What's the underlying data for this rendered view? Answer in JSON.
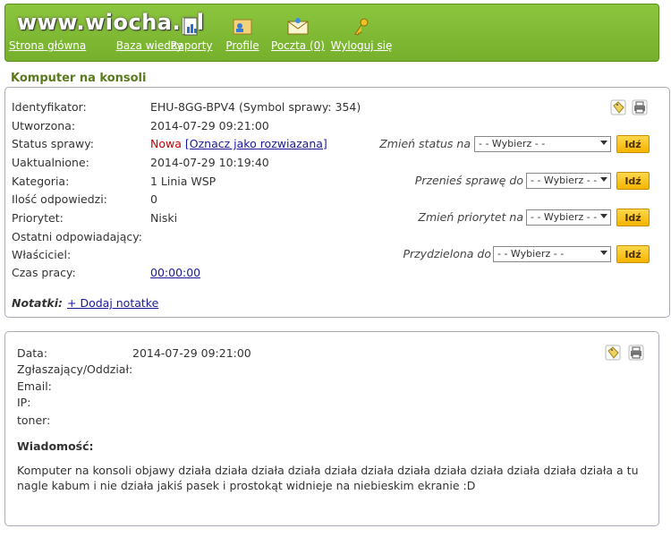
{
  "header": {
    "logo": "www.wiocha.pl",
    "nav": [
      {
        "label": "Strona główna",
        "icon": "home-icon"
      },
      {
        "label": "Baza wiedzy",
        "icon": "knowledge-base-icon"
      },
      {
        "label": "Raporty",
        "icon": "reports-icon"
      },
      {
        "label": "Profile",
        "icon": "profile-icon"
      },
      {
        "label": "Poczta (0)",
        "icon": "mail-icon"
      },
      {
        "label": "Wyloguj się",
        "icon": "key-icon"
      }
    ]
  },
  "page_title": "Komputer na konsoli",
  "ticket": {
    "fields": [
      {
        "label": "Identyfikator:",
        "value": "EHU-8GG-BPV4 (Symbol sprawy: 354)"
      },
      {
        "label": "Utworzona:",
        "value": "2014-07-29 09:21:00"
      },
      {
        "label": "Status sprawy:",
        "value": "Nowa",
        "link": "[Oznacz jako rozwiazana]"
      },
      {
        "label": "Uaktualnione:",
        "value": "2014-07-29 10:19:40"
      },
      {
        "label": "Kategoria:",
        "value": "1 Linia WSP"
      },
      {
        "label": "Ilość odpowiedzi:",
        "value": "0"
      },
      {
        "label": "Priorytet:",
        "value": "Niski"
      },
      {
        "label": "Ostatni odpowiadający:",
        "value": ""
      },
      {
        "label": "Właściciel:",
        "value": ""
      },
      {
        "label": "Czas pracy:",
        "value": "00:00:00"
      }
    ],
    "actions": [
      {
        "label": "Zmień status na",
        "select": "- - Wybierz - -",
        "button": "Idź"
      },
      {
        "label": "Przenieś sprawę do",
        "select": "- - Wybierz - -",
        "button": "Idź"
      },
      {
        "label": "Zmień priorytet na",
        "select": "- - Wybierz - -",
        "button": "Idź"
      },
      {
        "label": "Przydzielona do",
        "select": "- - Wybierz - -",
        "button": "Idź"
      }
    ],
    "notes_label": "Notatki:",
    "add_note": "+ Dodaj notatke",
    "status_color": "#cc0000"
  },
  "message": {
    "fields": [
      {
        "label": "Data:",
        "value": "2014-07-29 09:21:00"
      },
      {
        "label": "Zgłaszający/Oddział:",
        "value": ""
      },
      {
        "label": "Email:",
        "value": ""
      },
      {
        "label": "IP:",
        "value": ""
      },
      {
        "label": "toner:",
        "value": ""
      }
    ],
    "body_label": "Wiadomość:",
    "body": "Komputer na konsoli objawy działa działa działa działa działa działa działa działa działa działa działa działa a tu nagle kabum i nie działa jakiś pasek i prostokąt widnieje na niebieskim ekranie :D"
  },
  "colors": {
    "header_green": "#7ab833",
    "title_green": "#5b7a1e",
    "button_yellow": "#f5b400"
  }
}
